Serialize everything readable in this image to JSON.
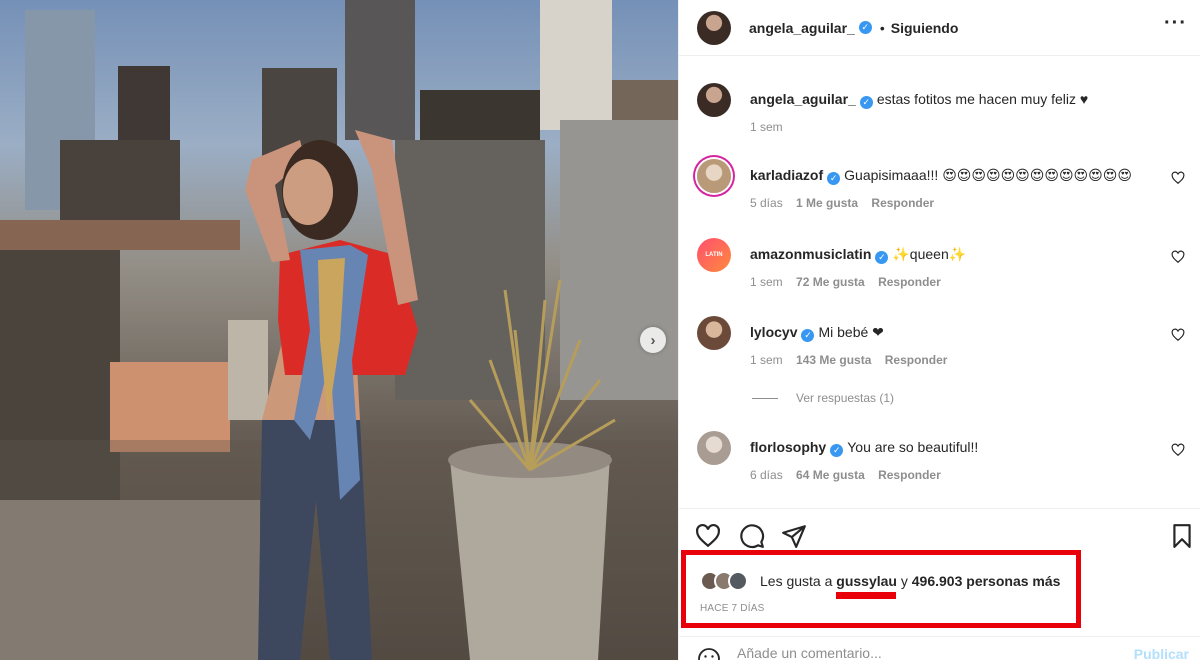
{
  "header": {
    "username": "angela_aguilar_",
    "separator": "•",
    "follow_status": "Siguiendo",
    "more_label": "···"
  },
  "caption": {
    "username": "angela_aguilar_",
    "text": "estas fotitos me hacen muy feliz ♥",
    "time": "1 sem"
  },
  "comments": [
    {
      "username": "karladiazof",
      "text": "Guapisimaaa!!! 😍😍😍😍😍😍😍😍😍😍😍😍😍",
      "time": "5 días",
      "likes": "1 Me gusta",
      "reply": "Responder",
      "verified": true
    },
    {
      "username": "amazonmusiclatin",
      "avatar_text": "LATIN",
      "text": "✨queen✨",
      "time": "1 sem",
      "likes": "72 Me gusta",
      "reply": "Responder",
      "verified": true
    },
    {
      "username": "lylocyv",
      "text": "Mi bebé ❤",
      "time": "1 sem",
      "likes": "143 Me gusta",
      "reply": "Responder",
      "verified": true
    },
    {
      "username": "florlosophy",
      "text": "You are so beautiful!!",
      "time": "6 días",
      "likes": "64 Me gusta",
      "reply": "Responder",
      "verified": true
    }
  ],
  "replies_link": "Ver respuestas (1)",
  "likes": {
    "prefix": "Les gusta a",
    "user": "gussylau",
    "conj": "y",
    "count": "496.903 personas más",
    "time_ago": "HACE 7 DÍAS"
  },
  "add_comment": {
    "placeholder": "Añade un comentario...",
    "publish_label": "Publicar"
  },
  "icons": {
    "verified": "verified-badge-icon",
    "like": "heart-icon",
    "comment": "comment-bubble-icon",
    "share": "paper-plane-icon",
    "save": "bookmark-icon",
    "emoji": "smiley-icon",
    "carousel": "chevron-right-icon"
  },
  "colors": {
    "verified": "#3897f0",
    "highlight": "#e8000b",
    "muted": "#8e8e8e",
    "publish": "#b2dffc"
  }
}
